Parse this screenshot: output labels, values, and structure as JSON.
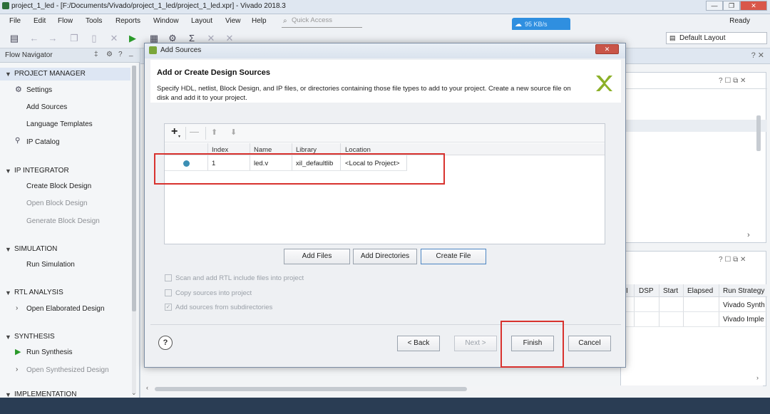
{
  "window": {
    "title": "project_1_led - [F:/Documents/Vivado/project_1_led/project_1_led.xpr] - Vivado 2018.3"
  },
  "menu": [
    "File",
    "Edit",
    "Flow",
    "Tools",
    "Reports",
    "Window",
    "Layout",
    "View",
    "Help"
  ],
  "quick_access": {
    "placeholder": "Quick Access"
  },
  "status": "Ready",
  "download_badge": "95 KB/s",
  "layout_select": "Default Layout",
  "flow_navigator": {
    "title": "Flow Navigator",
    "sections": [
      {
        "label": "PROJECT MANAGER",
        "items": [
          {
            "label": "Settings",
            "disabled": false
          },
          {
            "label": "Add Sources",
            "disabled": false
          },
          {
            "label": "Language Templates",
            "disabled": false
          },
          {
            "label": "IP Catalog",
            "disabled": false
          }
        ]
      },
      {
        "label": "IP INTEGRATOR",
        "items": [
          {
            "label": "Create Block Design",
            "disabled": false
          },
          {
            "label": "Open Block Design",
            "disabled": true
          },
          {
            "label": "Generate Block Design",
            "disabled": true
          }
        ]
      },
      {
        "label": "SIMULATION",
        "items": [
          {
            "label": "Run Simulation",
            "disabled": false
          }
        ]
      },
      {
        "label": "RTL ANALYSIS",
        "items": [
          {
            "label": "Open Elaborated Design",
            "disabled": false
          }
        ]
      },
      {
        "label": "SYNTHESIS",
        "items": [
          {
            "label": "Run Synthesis",
            "disabled": false
          },
          {
            "label": "Open Synthesized Design",
            "disabled": true
          }
        ]
      },
      {
        "label": "IMPLEMENTATION",
        "items": []
      }
    ]
  },
  "runs_table": {
    "headers": [
      "DSP",
      "Start",
      "Elapsed",
      "Run Strategy"
    ],
    "rows": [
      [
        "Vivado Synth"
      ],
      [
        "Vivado Imple"
      ]
    ]
  },
  "dialog": {
    "title": "Add Sources",
    "heading": "Add or Create Design Sources",
    "description": "Specify HDL, netlist, Block Design, and IP files, or directories containing those file types to add to your project. Create a new source file on disk and add it to your project.",
    "table": {
      "columns": [
        "Index",
        "Name",
        "Library",
        "Location"
      ],
      "rows": [
        {
          "index": "1",
          "name": "led.v",
          "library": "xil_defaultlib",
          "location": "<Local to Project>"
        }
      ]
    },
    "buttons": {
      "add_files": "Add Files",
      "add_directories": "Add Directories",
      "create_file": "Create File"
    },
    "options": [
      {
        "label": "Scan and add RTL include files into project",
        "checked": false
      },
      {
        "label": "Copy sources into project",
        "checked": false
      },
      {
        "label": "Add sources from subdirectories",
        "checked": true
      }
    ],
    "nav": {
      "back": "< Back",
      "next": "Next >",
      "finish": "Finish",
      "cancel": "Cancel"
    },
    "help": "?"
  },
  "colors": {
    "accent": "#2f8fe0",
    "highlight_box": "#d8322e",
    "xilinx_logo": "#8cb028",
    "dot": "#3c8fb4"
  }
}
